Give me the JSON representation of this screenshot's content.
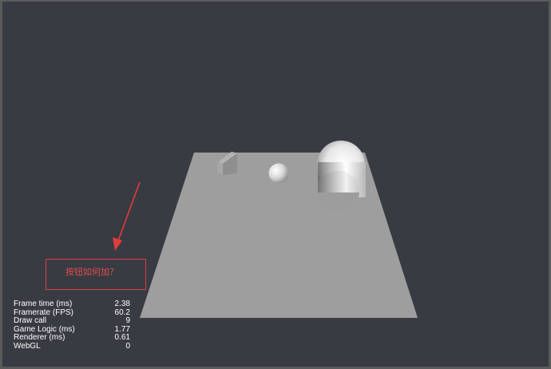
{
  "colors": {
    "background": "#383b42",
    "ground": "#9e9e9e",
    "annotation": "#e23b3b",
    "stats_text": "#ffffff"
  },
  "scene": {
    "objects": [
      "ground-plane",
      "cube",
      "sphere",
      "capsule"
    ]
  },
  "annotation": {
    "text": "按钮如何加？"
  },
  "stats": [
    {
      "label": "Frame time (ms)",
      "value": "2.38"
    },
    {
      "label": "Framerate (FPS)",
      "value": "60.2"
    },
    {
      "label": "Draw call",
      "value": "9"
    },
    {
      "label": "Game Logic (ms)",
      "value": "1.77"
    },
    {
      "label": "Renderer (ms)",
      "value": "0.61"
    },
    {
      "label": "WebGL",
      "value": "0"
    }
  ]
}
